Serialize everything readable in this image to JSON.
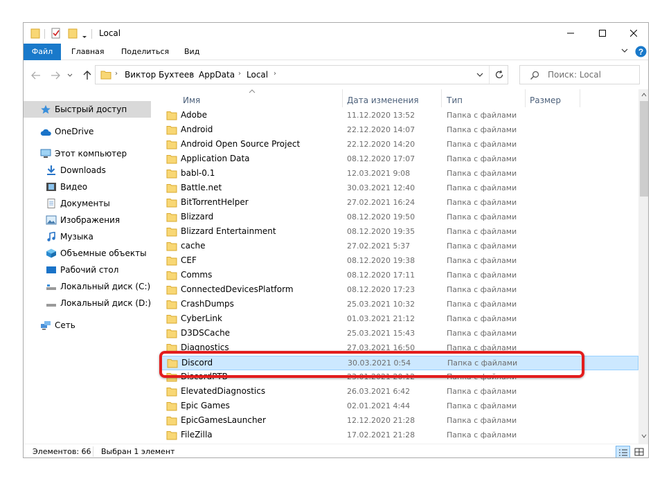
{
  "window": {
    "title": "Local"
  },
  "ribbon": {
    "tabs": [
      "Файл",
      "Главная",
      "Поделиться",
      "Вид"
    ]
  },
  "address": {
    "crumbs": [
      "Виктор Бухтеев",
      "AppData",
      "Local"
    ],
    "search_placeholder": "Поиск: Local"
  },
  "sidebar": {
    "items": [
      {
        "label": "Быстрый доступ",
        "icon": "star-icon"
      },
      {
        "label": "OneDrive",
        "icon": "cloud-icon"
      },
      {
        "label": "Этот компьютер",
        "icon": "computer-icon"
      },
      {
        "label": "Downloads",
        "icon": "download-icon"
      },
      {
        "label": "Видео",
        "icon": "video-icon"
      },
      {
        "label": "Документы",
        "icon": "document-icon"
      },
      {
        "label": "Изображения",
        "icon": "image-icon"
      },
      {
        "label": "Музыка",
        "icon": "music-icon"
      },
      {
        "label": "Объемные объекты",
        "icon": "3d-objects-icon"
      },
      {
        "label": "Рабочий стол",
        "icon": "desktop-icon"
      },
      {
        "label": "Локальный диск (C:)",
        "icon": "drive-icon"
      },
      {
        "label": "Локальный диск (D:)",
        "icon": "drive-icon"
      },
      {
        "label": "Сеть",
        "icon": "network-icon"
      }
    ]
  },
  "columns": {
    "name": "Имя",
    "date": "Дата изменения",
    "type": "Тип",
    "size": "Размер"
  },
  "files": [
    {
      "name": "Adobe",
      "date": "11.12.2020 13:52",
      "type": "Папка с файлами"
    },
    {
      "name": "Android",
      "date": "22.12.2020 14:07",
      "type": "Папка с файлами"
    },
    {
      "name": "Android Open Source Project",
      "date": "22.12.2020 14:20",
      "type": "Папка с файлами"
    },
    {
      "name": "Application Data",
      "date": "08.12.2020 17:07",
      "type": "Папка с файлами"
    },
    {
      "name": "babl-0.1",
      "date": "12.03.2021 9:08",
      "type": "Папка с файлами"
    },
    {
      "name": "Battle.net",
      "date": "30.03.2021 12:40",
      "type": "Папка с файлами"
    },
    {
      "name": "BitTorrentHelper",
      "date": "27.02.2021 16:24",
      "type": "Папка с файлами"
    },
    {
      "name": "Blizzard",
      "date": "08.12.2020 19:50",
      "type": "Папка с файлами"
    },
    {
      "name": "Blizzard Entertainment",
      "date": "08.12.2020 19:35",
      "type": "Папка с файлами"
    },
    {
      "name": "cache",
      "date": "27.02.2021 5:37",
      "type": "Папка с файлами"
    },
    {
      "name": "CEF",
      "date": "08.12.2020 19:38",
      "type": "Папка с файлами"
    },
    {
      "name": "Comms",
      "date": "08.12.2020 17:11",
      "type": "Папка с файлами"
    },
    {
      "name": "ConnectedDevicesPlatform",
      "date": "08.12.2020 17:23",
      "type": "Папка с файлами"
    },
    {
      "name": "CrashDumps",
      "date": "25.03.2021 10:32",
      "type": "Папка с файлами"
    },
    {
      "name": "CyberLink",
      "date": "01.03.2021 21:12",
      "type": "Папка с файлами"
    },
    {
      "name": "D3DSCache",
      "date": "25.03.2021 15:43",
      "type": "Папка с файлами"
    },
    {
      "name": "Diagnostics",
      "date": "27.03.2021 16:50",
      "type": "Папка с файлами"
    },
    {
      "name": "Discord",
      "date": "30.03.2021 0:54",
      "type": "Папка с файлами"
    },
    {
      "name": "DiscordPTB",
      "date": "23.01.2021 20:12",
      "type": "Папка с файлами"
    },
    {
      "name": "ElevatedDiagnostics",
      "date": "26.03.2021 6:42",
      "type": "Папка с файлами"
    },
    {
      "name": "Epic Games",
      "date": "02.01.2021 4:44",
      "type": "Папка с файлами"
    },
    {
      "name": "EpicGamesLauncher",
      "date": "12.12.2020 21:28",
      "type": "Папка с файлами"
    },
    {
      "name": "FileZilla",
      "date": "17.02.2021 21:28",
      "type": "Папка с файлами"
    }
  ],
  "status": {
    "count": "Элементов: 66",
    "selected": "Выбран 1 элемент"
  }
}
